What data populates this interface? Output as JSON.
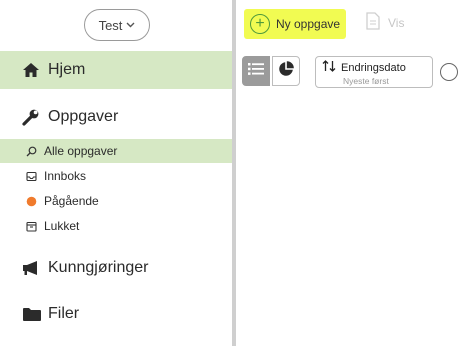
{
  "sidebar": {
    "workspace_select": {
      "value": "Test"
    },
    "items": [
      {
        "label": "Hjem",
        "icon": "home-icon",
        "active": true
      },
      {
        "label": "Oppgaver",
        "icon": "wrench-icon",
        "active": false
      },
      {
        "label": "Kunngjøringer",
        "icon": "megaphone-icon",
        "active": false
      },
      {
        "label": "Filer",
        "icon": "folder-icon",
        "active": false
      }
    ],
    "subitems": [
      {
        "label": "Alle oppgaver",
        "icon": "search-icon",
        "active": true
      },
      {
        "label": "Innboks",
        "icon": "inbox-icon",
        "active": false
      },
      {
        "label": "Pågående",
        "icon": "in-progress-dot-icon",
        "active": false
      },
      {
        "label": "Lukket",
        "icon": "closed-box-icon",
        "active": false
      }
    ]
  },
  "toolbar": {
    "new_task_label": "Ny oppgave",
    "show_label": "Vis"
  },
  "sort": {
    "title": "Endringsdato",
    "subtitle": "Nyeste først"
  },
  "colors": {
    "active_nav": "#d6e8c4",
    "highlight": "#f1fb52",
    "accent_green": "#4f9a3b",
    "in_progress": "#f07b2d"
  }
}
